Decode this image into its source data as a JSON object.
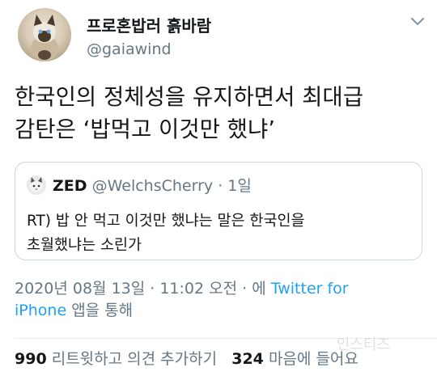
{
  "author": {
    "display_name": "프로혼밥러 흙바람",
    "handle": "@gaiawind"
  },
  "tweet": {
    "line1": "한국인의 정체성을 유지하면서 최대급",
    "line2": "감탄은 ‘밥먹고 이것만 했냐’"
  },
  "quoted": {
    "name": "ZED",
    "handle": "@WelchsCherry",
    "separator": "·",
    "time": "1일",
    "line1": "RT) 밥 안 먹고 이것만 했냐는 말은 한국인을",
    "line2": "초월했냐는 소린가"
  },
  "meta": {
    "timestamp": "2020년 08월 13일 · 11:02 오전 ·",
    "via": "에",
    "source_part1": "Twitter for",
    "source_part2": "iPhone",
    "suffix": "앱을 통해"
  },
  "stats": {
    "retweets": "990",
    "retweets_label": "리트윗하고 의견 추가하기",
    "likes": "324",
    "likes_label": "마음에 들어요"
  },
  "watermark": "인스티즈",
  "colors": {
    "link": "#1da1f2",
    "secondary_text": "#657786",
    "border": "#ccd6dd"
  },
  "icons": {
    "more": "chevron-down-icon",
    "avatar": "cat-avatar",
    "quoted_avatar": "cat-avatar-small"
  }
}
